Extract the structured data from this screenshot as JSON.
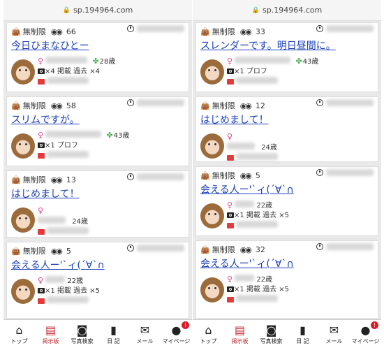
{
  "url": "sp.194964.com",
  "left": {
    "cards": [
      {
        "limit": "無制限",
        "views": "66",
        "title": "今日ひまなひとー",
        "age": "28歳",
        "line2": "×4 掲載 過去 ×4"
      },
      {
        "limit": "無制限",
        "views": "58",
        "title": "スリムですが。",
        "age": "43歳",
        "line2": "×1 プロフ"
      },
      {
        "limit": "無制限",
        "views": "13",
        "title": "はじめまして！",
        "age": "24歳",
        "line2": ""
      },
      {
        "limit": "無制限",
        "views": "5",
        "title": "会える人ー'`ィ(´∀`∩",
        "age": "22歳",
        "line2": "×1 掲載 過去 ×5"
      }
    ]
  },
  "right": {
    "cards": [
      {
        "limit": "無制限",
        "views": "33",
        "title": "スレンダーです。明日昼間に。",
        "age": "43歳",
        "line2": "×1 プロフ"
      },
      {
        "limit": "無制限",
        "views": "12",
        "title": "はじめまして！",
        "age": "24歳",
        "line2": ""
      },
      {
        "limit": "無制限",
        "views": "5",
        "title": "会える人ー'`ィ(´∀`∩",
        "age": "22歳",
        "line2": "×1 掲載 過去 ×5"
      },
      {
        "limit": "無制限",
        "views": "32",
        "title": "会える人ー'`ィ(´∀`∩",
        "age": "22歳",
        "line2": "×1 掲載 過去 ×5"
      }
    ]
  },
  "tabs": [
    {
      "label": "トップ",
      "icon": "home-icon"
    },
    {
      "label": "掲示板",
      "icon": "board-icon"
    },
    {
      "label": "写真検索",
      "icon": "camera-icon"
    },
    {
      "label": "日 記",
      "icon": "diary-icon"
    },
    {
      "label": "メール",
      "icon": "mail-icon"
    },
    {
      "label": "マイページ",
      "icon": "person-icon",
      "badge": "!"
    }
  ],
  "colors": {
    "link": "#1a3fb8",
    "accent": "#c0242c",
    "female": "#e0418a"
  }
}
